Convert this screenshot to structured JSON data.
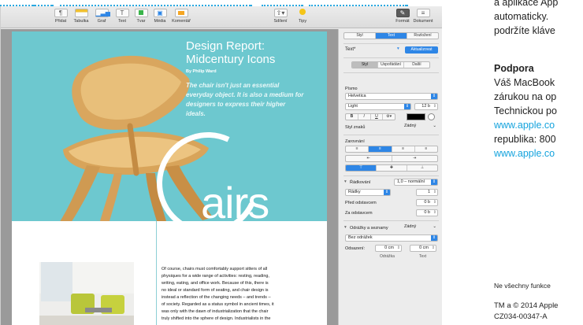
{
  "toolbar": {
    "insert": "Přidat",
    "table": "Tabulka",
    "chart": "Graf",
    "text": "Text",
    "shape": "Tvar",
    "media": "Média",
    "comment": "Komentář",
    "share": "Sdílení",
    "tips": "Tipy",
    "format": "Formát",
    "document": "Dokument"
  },
  "document": {
    "title_line1": "Design Report:",
    "title_line2": "Midcentury Icons",
    "byline": "By Philip Ward",
    "pull_quote": "The chair isn't just an essential everyday object. It is also a medium for designers to express their higher ideals.",
    "big_word": "airs",
    "body_lines": [
      "Of course, chairs must comfortably support sitters of all",
      "physiques for a wide range of activities: resting, reading,",
      "writing, eating, and office work. Because of this, there is",
      "no ideal or standard form of seating, and chair design is",
      "instead a reflection of the changing needs – and trends –",
      "of society. Regarded as a status symbol in ancient times, it",
      "was only with the dawn of industrialization that the chair",
      "truly shifted into the sphere of design. Industrialists in the"
    ]
  },
  "inspector": {
    "tabs": [
      "Styl",
      "Text",
      "Rozložení"
    ],
    "active_tab": "Text",
    "paragraph_style": "Text*",
    "update_button": "Aktualizovat",
    "subtabs": [
      "Styl",
      "Uspořádání",
      "Další"
    ],
    "font_section": "Písmo",
    "font_family": "Helvetica",
    "font_weight": "Light",
    "font_size": "12 b",
    "char_style_label": "Styl znaků",
    "char_style_value": "Žádný",
    "alignment_section": "Zarovnání",
    "spacing_label": "Řádkování",
    "spacing_value": "1,0 – normální",
    "lines_label": "Řádky",
    "lines_value": "1",
    "before_label": "Před odstavcem",
    "before_value": "0 b",
    "after_label": "Za odstavcem",
    "after_value": "0 b",
    "bullets_label": "Odrážky a seznamy",
    "bullets_value": "Žádný",
    "bullet_type": "Bez odrážek",
    "indent_label": "Odsazení:",
    "indent_bullet_value": "0 cm",
    "indent_text_value": "0 cm",
    "indent_bullet_caption": "Odrážka",
    "indent_text_caption": "Text",
    "font_style_buttons": [
      "B",
      "I",
      "U"
    ],
    "colors": {
      "accent": "#2e86e6",
      "text_color_well": "#000000"
    }
  },
  "manual": {
    "line1": "a aplikace App",
    "line2": "automaticky.",
    "line3": "podržíte kláve",
    "heading": "Podpora",
    "line4": "Váš MacBook",
    "line5": "zárukou na op",
    "line6": "Technickou po",
    "link1": "www.apple.co",
    "line7": "republika: 800",
    "link2": "www.apple.co",
    "footnote": "Ne všechny funkce",
    "copyright": "TM a © 2014 Apple",
    "code": "CZ034-00347-A"
  },
  "colors": {
    "callout": "#29a8e0",
    "hero_bg": "#6dc8cf",
    "link": "#14a3dd"
  }
}
